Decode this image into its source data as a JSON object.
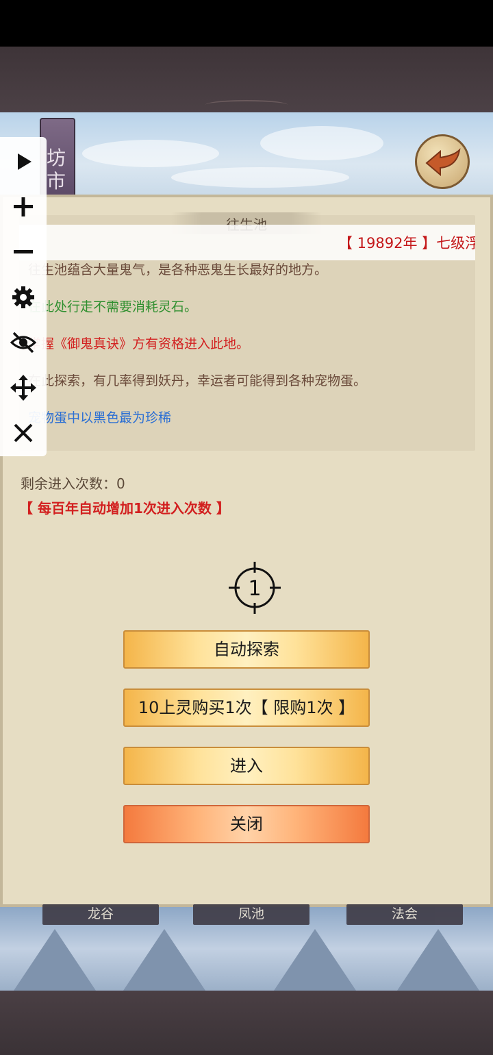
{
  "header": {
    "banner_text": "坊市"
  },
  "dialog": {
    "title": "往生池",
    "marquee": "【 19892年 】七级浮",
    "lines": [
      "往生池蕴含大量鬼气，是各种恶鬼生长最好的地方。",
      "在此处行走不需要消耗灵石。",
      "掌握《御鬼真诀》方有资格进入此地。",
      "在此探索，有几率得到妖丹，幸运者可能得到各种宠物蛋。",
      "宠物蛋中以黑色最为珍稀"
    ],
    "line_colors": [
      "#6a4a3a",
      "#2f8f2f",
      "#d21f1f",
      "#6a4a3a",
      "#2b6fd4"
    ],
    "remaining": "剩余进入次数：0",
    "hint": "【 每百年自动增加1次进入次数 】",
    "target_number": "1",
    "buttons": {
      "auto_explore": "自动探索",
      "buy_once": "10上灵购买1次【 限购1次 】",
      "enter": "进入",
      "close": "关闭"
    }
  },
  "bottom_tabs": [
    "龙谷",
    "凤池",
    "法会"
  ],
  "toolbar_icons": [
    "play-icon",
    "plus-icon",
    "minus-icon",
    "gear-icon",
    "eye-off-icon",
    "move-icon",
    "close-icon"
  ]
}
